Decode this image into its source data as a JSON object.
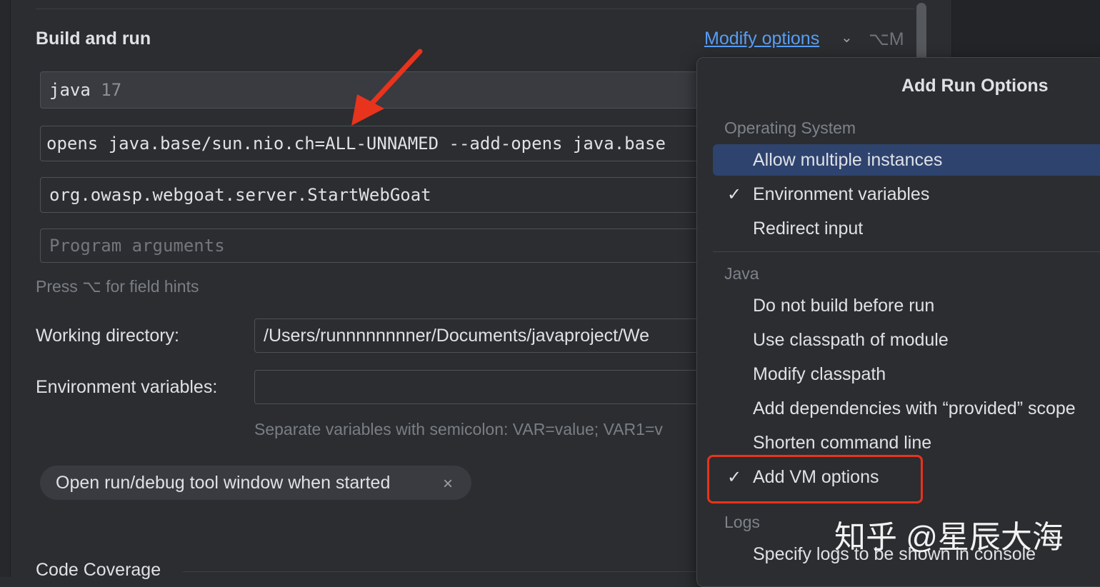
{
  "section": {
    "title": "Build and run",
    "modify_options": "Modify options",
    "modify_shortcut": "⌥M"
  },
  "fields": {
    "sdk_name": "java",
    "sdk_version": "17",
    "vm_options": "opens java.base/sun.nio.ch=ALL-UNNAMED --add-opens java.base",
    "main_class": "org.owasp.webgoat.server.StartWebGoat",
    "program_arguments_placeholder": "Program arguments",
    "field_hint": "Press ⌥ for field hints",
    "working_directory_label": "Working directory:",
    "working_directory_value": "/Users/runnnnnnnner/Documents/javaproject/We",
    "env_vars_label": "Environment variables:",
    "env_vars_value": "",
    "env_vars_hint": "Separate variables with semicolon: VAR=value; VAR1=v"
  },
  "chip": {
    "label": "Open run/debug tool window when started",
    "close": "×"
  },
  "coverage": {
    "title": "Code Coverage"
  },
  "popup": {
    "title": "Add Run Options",
    "groups": [
      {
        "header": "Operating System",
        "items": [
          {
            "label": "Allow multiple instances",
            "checked": false,
            "selected": true
          },
          {
            "label": "Environment variables",
            "checked": true,
            "selected": false
          },
          {
            "label": "Redirect input",
            "checked": false,
            "selected": false
          }
        ]
      },
      {
        "header": "Java",
        "items": [
          {
            "label": "Do not build before run",
            "checked": false
          },
          {
            "label": "Use classpath of module",
            "checked": false
          },
          {
            "label": "Modify classpath",
            "checked": false
          },
          {
            "label": "Add dependencies with “provided” scope",
            "checked": false
          },
          {
            "label": "Shorten command line",
            "checked": false
          },
          {
            "label": "Add VM options",
            "checked": true
          }
        ]
      },
      {
        "header": "Logs",
        "items": [
          {
            "label": "Specify logs to be shown in console",
            "checked": false
          }
        ]
      }
    ],
    "check_glyph": "✓"
  },
  "watermark": "知乎 @星辰大海",
  "colors": {
    "background": "#2b2d30",
    "link": "#589df6",
    "selection": "#2e436e",
    "annotation": "#e8331d"
  },
  "icons": {
    "chevron": "chevron-down-icon",
    "close": "close-icon",
    "check": "checkmark-icon"
  }
}
